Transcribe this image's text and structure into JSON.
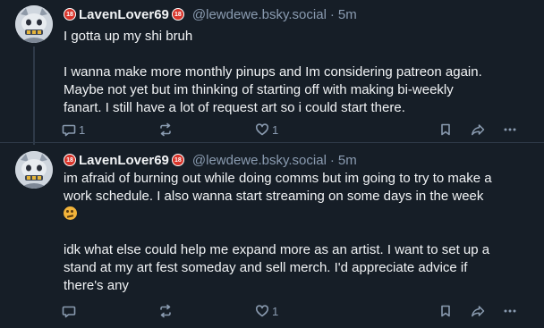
{
  "posts": [
    {
      "display_name": "LavenLover69",
      "handle": "@lewdewe.bsky.social",
      "separator": "·",
      "time": "5m",
      "badge_text": "18",
      "paragraphs": [
        [
          "I gotta up my shi bruh"
        ],
        [
          "I wanna make more monthly pinups and Im considering patreon again.",
          "Maybe not yet but im thinking of starting off with making bi-weekly",
          "fanart. I still have a lot of request art so i could start there."
        ]
      ],
      "reply_count": "1",
      "repost_count": "",
      "like_count": "1",
      "icons": [
        "reply-icon",
        "repost-icon",
        "like-icon",
        "bookmark-icon",
        "share-icon",
        "more-icon"
      ]
    },
    {
      "display_name": "LavenLover69",
      "handle": "@lewdewe.bsky.social",
      "separator": "·",
      "time": "5m",
      "badge_text": "18",
      "paragraphs": [
        [
          "im afraid of burning out while doing comms but im going to try to make a",
          "work schedule. I also wanna start streaming on some days in the week"
        ],
        [
          "idk what else could help me expand more as an artist. I want to set up a",
          "stand at my art fest someday and sell merch. I'd appreciate advice if",
          "there's any"
        ]
      ],
      "reply_count": "",
      "repost_count": "",
      "like_count": "1",
      "icons": [
        "reply-icon",
        "repost-icon",
        "like-icon",
        "bookmark-icon",
        "share-icon",
        "more-icon"
      ]
    }
  ],
  "colors": {
    "background": "#161e27",
    "text": "#f1f3f5",
    "muted": "#8a9bb0",
    "divider": "#2e3a48",
    "badge": "#d8342a"
  }
}
